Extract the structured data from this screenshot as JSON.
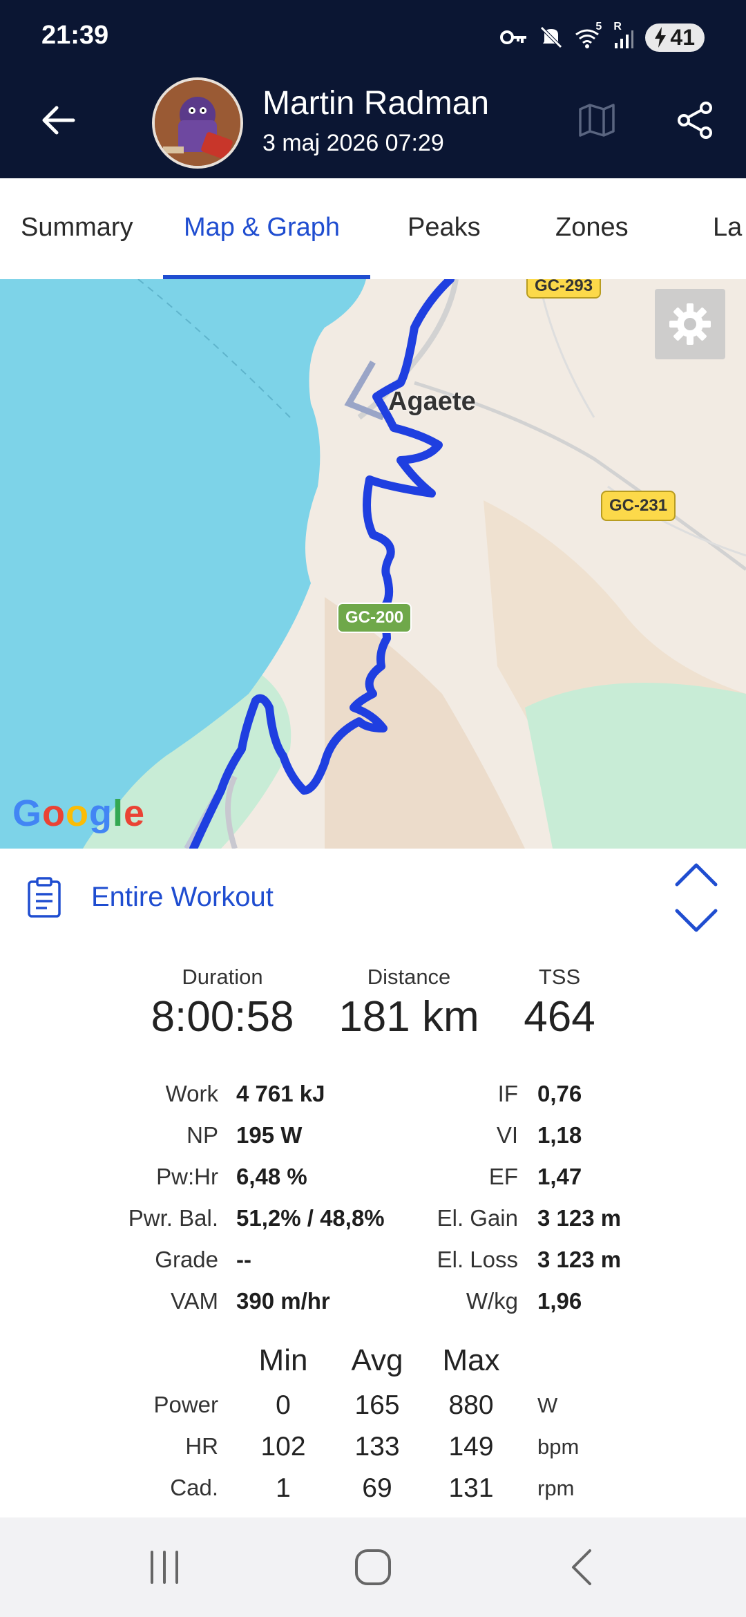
{
  "status_bar": {
    "time": "21:39",
    "battery": "41",
    "signal_label": "5",
    "roaming_label": "R"
  },
  "header": {
    "user_name": "Martin Radman",
    "date": "3 maj 2026 07:29",
    "avatar_text": "LÖFBERGS LILA"
  },
  "tabs": [
    {
      "label": "Summary",
      "active": false
    },
    {
      "label": "Map & Graph",
      "active": true
    },
    {
      "label": "Peaks",
      "active": false
    },
    {
      "label": "Zones",
      "active": false
    },
    {
      "label": "La",
      "active": false
    }
  ],
  "map": {
    "place_label": "Agaete",
    "road_labels": [
      "GC-293",
      "GC-231",
      "GC-200"
    ],
    "attribution": "Google",
    "colors": {
      "route": "#1f3fe0",
      "water": "#7dd3e8",
      "land": "#f2ebe3",
      "vegetation": "#c8ecd6"
    }
  },
  "workout": {
    "selector_label": "Entire Workout",
    "headline": [
      {
        "label": "Duration",
        "value": "8:00:58"
      },
      {
        "label": "Distance",
        "value": "181 km"
      },
      {
        "label": "TSS",
        "value": "464"
      }
    ],
    "left_metrics": [
      {
        "label": "Work",
        "value": "4 761 kJ"
      },
      {
        "label": "NP",
        "value": "195 W"
      },
      {
        "label": "Pw:Hr",
        "value": "6,48 %"
      },
      {
        "label": "Pwr. Bal.",
        "value": "51,2% / 48,8%"
      },
      {
        "label": "Grade",
        "value": "--"
      },
      {
        "label": "VAM",
        "value": "390 m/hr"
      }
    ],
    "right_metrics": [
      {
        "label": "IF",
        "value": "0,76"
      },
      {
        "label": "VI",
        "value": "1,18"
      },
      {
        "label": "EF",
        "value": "1,47"
      },
      {
        "label": "El. Gain",
        "value": "3 123 m"
      },
      {
        "label": "El. Loss",
        "value": "3 123 m"
      },
      {
        "label": "W/kg",
        "value": "1,96"
      }
    ],
    "minmax_headers": [
      "Min",
      "Avg",
      "Max"
    ],
    "minmax_rows": [
      {
        "label": "Power",
        "min": "0",
        "avg": "165",
        "max": "880",
        "unit": "W"
      },
      {
        "label": "HR",
        "min": "102",
        "avg": "133",
        "max": "149",
        "unit": "bpm"
      },
      {
        "label": "Cad.",
        "min": "1",
        "avg": "69",
        "max": "131",
        "unit": "rpm"
      }
    ]
  },
  "theme": {
    "header_bg": "#0b1633",
    "accent": "#1f4dd0"
  }
}
